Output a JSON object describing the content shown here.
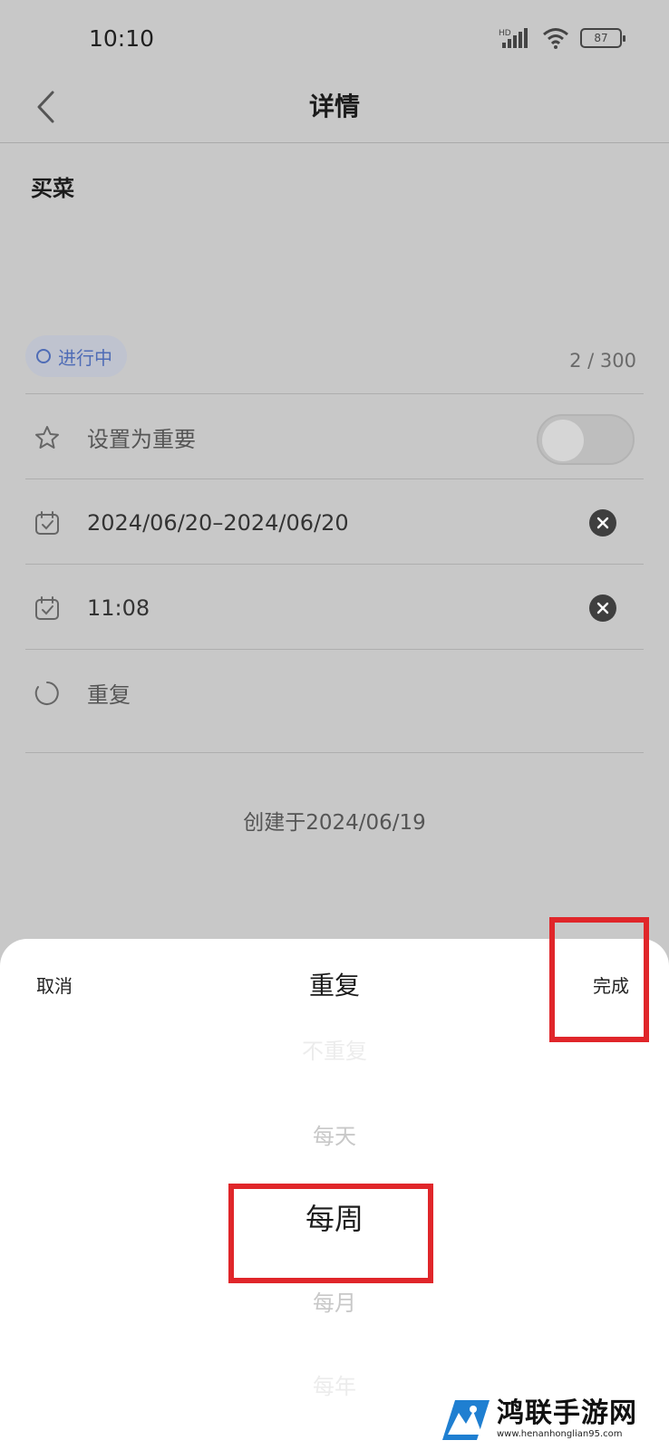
{
  "status_bar": {
    "time": "10:10",
    "network": "HD",
    "battery": "87"
  },
  "header": {
    "title": "详情"
  },
  "task": {
    "title": "买菜",
    "status_chip": "进行中",
    "char_count": "2 / 300"
  },
  "rows": {
    "important_label": "设置为重要",
    "important_on": false,
    "date_range": "2024/06/20–2024/06/20",
    "time": "11:08",
    "repeat_label": "重复"
  },
  "created_at": "创建于2024/06/19",
  "sheet": {
    "cancel_label": "取消",
    "title": "重复",
    "done_label": "完成",
    "options": [
      "不重复",
      "每天",
      "每周",
      "每月",
      "每年"
    ],
    "selected": "每周"
  },
  "annotation_color": "#e0262a",
  "watermark": {
    "name": "鸿联手游网",
    "url": "www.henanhonglian95.com"
  }
}
